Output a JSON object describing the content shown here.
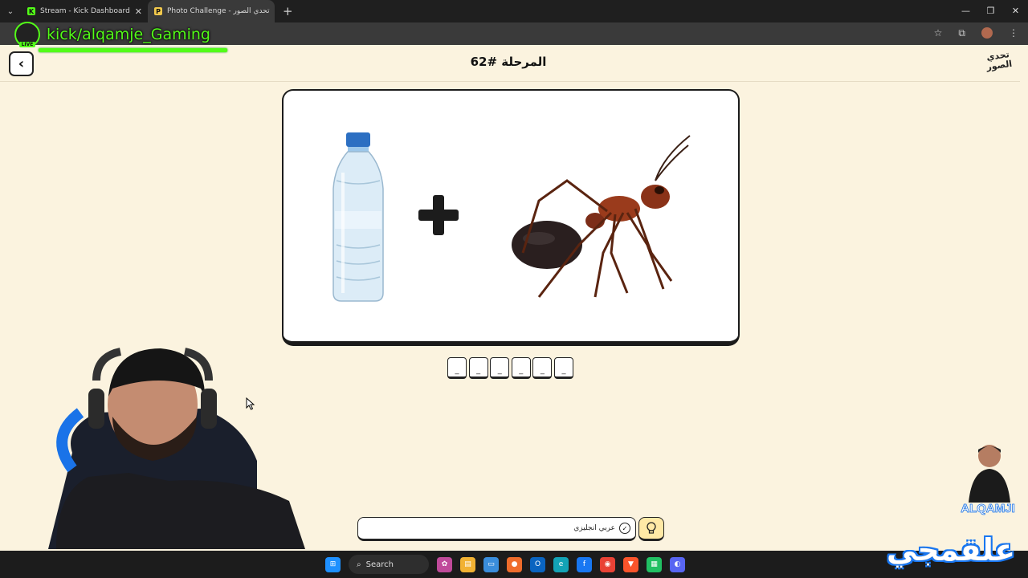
{
  "browser": {
    "tabs": [
      {
        "title": "Stream - Kick Dashboard",
        "favicon": "K",
        "favicon_color": "#53fc18",
        "active": false
      },
      {
        "title": "Photo Challenge - تحدي الصور",
        "favicon": "P",
        "favicon_color": "#f2c94c",
        "active": true
      }
    ],
    "new_tab_label": "+",
    "window_controls": [
      "—",
      "❐",
      "✕"
    ]
  },
  "overlay": {
    "live_label": "LIVE",
    "channel": "kick/alqamje_Gaming",
    "accent_color": "#53fc18"
  },
  "app": {
    "back_icon": "‹",
    "level_title": "المرحلة #62",
    "logo_text": "تحدي الصور"
  },
  "puzzle": {
    "images": [
      "water-bottle",
      "plus-sign",
      "ant"
    ],
    "answer_slots": [
      "_",
      "_",
      "_",
      "_",
      "_",
      "_"
    ]
  },
  "controls": {
    "language_toggle": "عربي انجليزي",
    "hint_icon": "lightbulb-icon"
  },
  "taskbar": {
    "search_label": "Search"
  },
  "branding": {
    "streamer_name": "ALQAMJI",
    "signature": "علقمجي"
  }
}
